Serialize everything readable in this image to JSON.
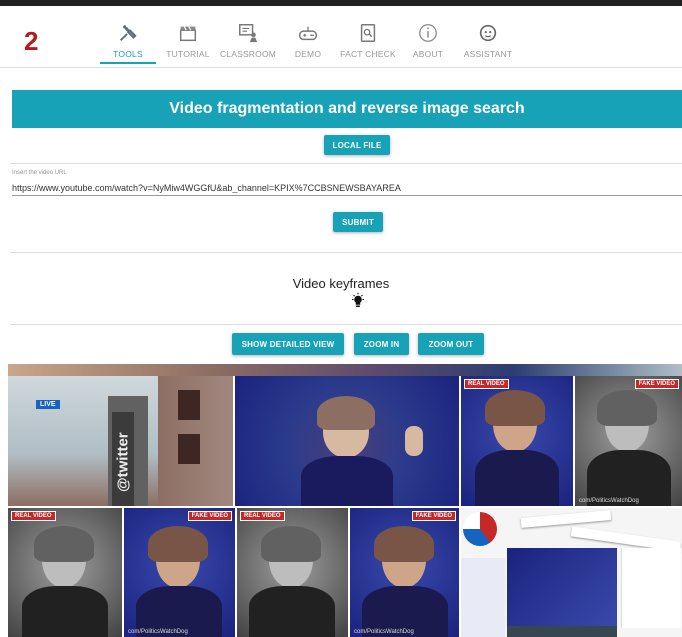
{
  "app": {
    "logo": "2"
  },
  "nav": [
    {
      "label": "TOOLS",
      "icon": "tools-icon",
      "active": true
    },
    {
      "label": "TUTORIAL",
      "icon": "clapperboard-icon",
      "active": false
    },
    {
      "label": "CLASSROOM",
      "icon": "classroom-icon",
      "active": false
    },
    {
      "label": "DEMO",
      "icon": "gamepad-icon",
      "active": false
    },
    {
      "label": "FACT CHECK",
      "icon": "fact-check-icon",
      "active": false
    },
    {
      "label": "ABOUT",
      "icon": "info-icon",
      "active": false
    },
    {
      "label": "ASSISTANT",
      "icon": "assistant-icon",
      "active": false
    }
  ],
  "tool": {
    "title": "Video fragmentation and reverse image search",
    "local_file": "LOCAL FILE",
    "url_label": "Insert the video URL",
    "url_value": "https://www.youtube.com/watch?v=NyMiw4WGGfU&ab_channel=KPIX%7CCBSNEWSBAYAREA",
    "submit": "SUBMIT"
  },
  "keyframes": {
    "title": "Video keyframes",
    "show_detailed": "SHOW DETAILED VIEW",
    "zoom_in": "ZOOM IN",
    "zoom_out": "ZOOM OUT"
  },
  "frames": {
    "live": "LIVE",
    "twitter": "@twitter",
    "real_tag": "REAL VIDEO",
    "fake_tag": "FAKE VIDEO",
    "watermark": "com/PoliticsWatchDog"
  },
  "colors": {
    "accent": "#17a2b8",
    "logo": "#b71c1c",
    "tag": "#c62828"
  }
}
